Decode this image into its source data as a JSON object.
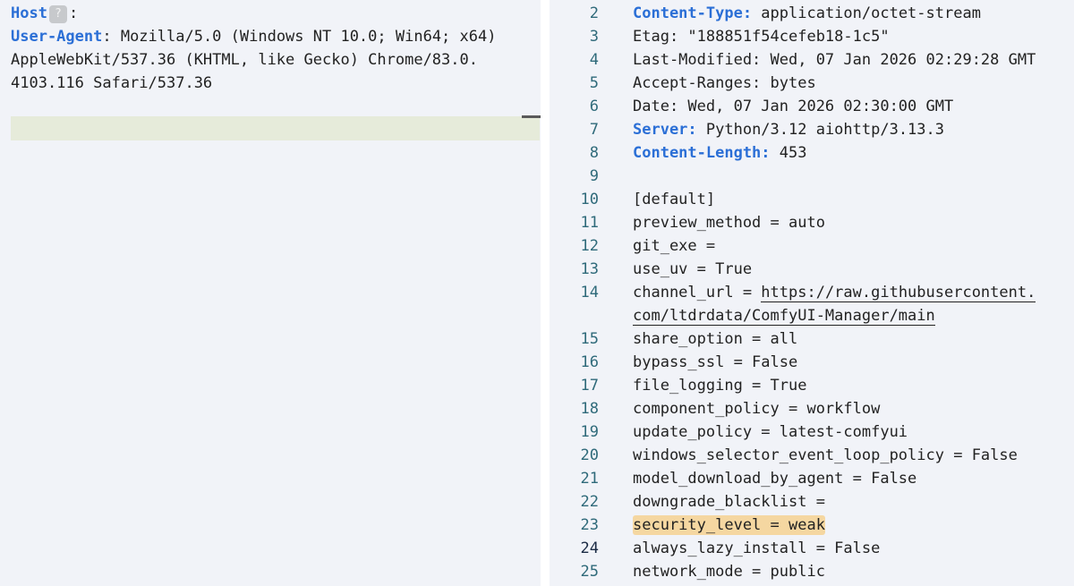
{
  "request": {
    "lines": [
      {
        "segments": [
          {
            "t": "Host",
            "k": "key"
          },
          {
            "t": "?",
            "k": "badge"
          },
          {
            "t": ":",
            "k": "plain"
          },
          {
            "t": " ",
            "k": "ws"
          }
        ]
      },
      {
        "segments": [
          {
            "t": "User-Agent",
            "k": "key"
          },
          {
            "t": ": Mozilla/5.0 (Windows NT 10.0; Win64; x64) ",
            "k": "plain"
          }
        ]
      },
      {
        "segments": [
          {
            "t": "AppleWebKit/537.36 (KHTML, like Gecko) Chrome/83.0.",
            "k": "plain"
          }
        ]
      },
      {
        "segments": [
          {
            "t": "4103.116 Safari/537.36",
            "k": "plain"
          }
        ]
      }
    ]
  },
  "response": {
    "lines": [
      {
        "n": "2",
        "segments": [
          {
            "t": "Content-Type:",
            "k": "key"
          },
          {
            "t": " application/octet-stream",
            "k": "plain"
          }
        ]
      },
      {
        "n": "3",
        "segments": [
          {
            "t": "Etag: \"188851f54cefeb18-1c5\"",
            "k": "plain"
          }
        ]
      },
      {
        "n": "4",
        "segments": [
          {
            "t": "Last-Modified: Wed, 07 Jan 2026 02:29:28 GMT",
            "k": "plain"
          }
        ]
      },
      {
        "n": "5",
        "segments": [
          {
            "t": "Accept-Ranges: bytes",
            "k": "plain"
          }
        ]
      },
      {
        "n": "6",
        "segments": [
          {
            "t": "Date: Wed, 07 Jan 2026 02:30:00 GMT",
            "k": "plain"
          }
        ]
      },
      {
        "n": "7",
        "segments": [
          {
            "t": "Server:",
            "k": "key"
          },
          {
            "t": " Python/3.12 aiohttp/3.13.3",
            "k": "plain"
          }
        ]
      },
      {
        "n": "8",
        "segments": [
          {
            "t": "Content-Length:",
            "k": "key"
          },
          {
            "t": " 453",
            "k": "plain"
          }
        ]
      },
      {
        "n": "9",
        "segments": []
      },
      {
        "n": "10",
        "segments": [
          {
            "t": "[default]",
            "k": "plain"
          }
        ]
      },
      {
        "n": "11",
        "segments": [
          {
            "t": "preview_method = auto",
            "k": "plain"
          }
        ]
      },
      {
        "n": "12",
        "segments": [
          {
            "t": "git_exe = ",
            "k": "plain"
          }
        ]
      },
      {
        "n": "13",
        "segments": [
          {
            "t": "use_uv = True",
            "k": "plain"
          }
        ]
      },
      {
        "n": "14",
        "segments": [
          {
            "t": "channel_url = ",
            "k": "plain"
          },
          {
            "t": "https://raw.githubusercontent.",
            "k": "url"
          }
        ]
      },
      {
        "n": "",
        "segments": [
          {
            "t": "com/ltdrdata/ComfyUI-Manager/main",
            "k": "url"
          }
        ]
      },
      {
        "n": "15",
        "segments": [
          {
            "t": "share_option = all",
            "k": "plain"
          }
        ]
      },
      {
        "n": "16",
        "segments": [
          {
            "t": "bypass_ssl = False",
            "k": "plain"
          }
        ]
      },
      {
        "n": "17",
        "segments": [
          {
            "t": "file_logging = True",
            "k": "plain"
          }
        ]
      },
      {
        "n": "18",
        "segments": [
          {
            "t": "component_policy = workflow",
            "k": "plain"
          }
        ]
      },
      {
        "n": "19",
        "segments": [
          {
            "t": "update_policy = latest-comfyui",
            "k": "plain"
          }
        ]
      },
      {
        "n": "20",
        "segments": [
          {
            "t": "windows_selector_event_loop_policy = False",
            "k": "plain"
          }
        ]
      },
      {
        "n": "21",
        "segments": [
          {
            "t": "model_download_by_agent = False",
            "k": "plain"
          }
        ]
      },
      {
        "n": "22",
        "segments": [
          {
            "t": "downgrade_blacklist = ",
            "k": "plain"
          }
        ]
      },
      {
        "n": "23",
        "segments": [
          {
            "t": "security_level = weak",
            "k": "highlight"
          }
        ]
      },
      {
        "n": "24",
        "current": true,
        "segments": [
          {
            "t": "always_lazy_install = False",
            "k": "plain"
          }
        ]
      },
      {
        "n": "25",
        "segments": [
          {
            "t": "network_mode = public",
            "k": "plain"
          }
        ]
      }
    ]
  },
  "colors": {
    "key": "#2b6fd6",
    "gutter": "#2f6a7a",
    "highlight": "#f5d7a1",
    "active_line": "#e6ebda"
  }
}
